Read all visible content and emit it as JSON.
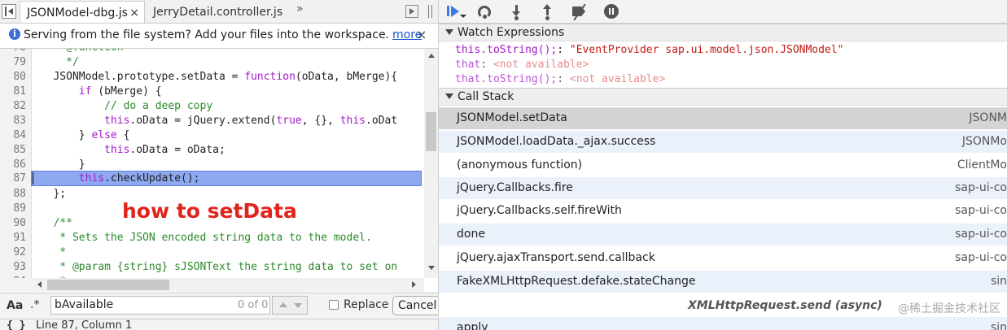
{
  "tabs": [
    {
      "label": "JSONModel-dbg.js",
      "close": "×"
    },
    {
      "label": "JerryDetail.controller.js"
    }
  ],
  "tabs_more": "»",
  "infobar": {
    "text": "Serving from the file system? Add your files into the workspace.",
    "link": "more",
    "close": "×"
  },
  "code_lines": [
    {
      "num": "78",
      "text": "     @function"
    },
    {
      "num": "79",
      "text": "     */"
    },
    {
      "num": "80",
      "text": "   JSONModel.prototype.setData = function(oData, bMerge){"
    },
    {
      "num": "81",
      "text": "       if (bMerge) {"
    },
    {
      "num": "82",
      "text": "           // do a deep copy"
    },
    {
      "num": "83",
      "text": "           this.oData = jQuery.extend(true, {}, this.oDat"
    },
    {
      "num": "84",
      "text": "       } else {"
    },
    {
      "num": "85",
      "text": "           this.oData = oData;"
    },
    {
      "num": "86",
      "text": "       }"
    },
    {
      "num": "87",
      "text": "       this.checkUpdate();"
    },
    {
      "num": "88",
      "text": "   };"
    },
    {
      "num": "89",
      "text": ""
    },
    {
      "num": "90",
      "text": "   /**"
    },
    {
      "num": "91",
      "text": "    * Sets the JSON encoded string data to the model."
    },
    {
      "num": "92",
      "text": "    *"
    },
    {
      "num": "93",
      "text": "    * @param {string} sJSONText the string data to set on"
    },
    {
      "num": "94",
      "text": "    *"
    }
  ],
  "annotation": "how to setData",
  "search": {
    "case_label": "Aa",
    "regex_label": ".*",
    "value": "bAvailable",
    "count": "0 of 0",
    "replace_label": "Replace",
    "cancel_label": "Cancel"
  },
  "status": {
    "braces": "{ }",
    "position": "Line 87, Column 1"
  },
  "watch": {
    "title": "Watch Expressions",
    "items": [
      {
        "name": "this.toString();",
        "sep": ": ",
        "value": "\"EventProvider sap.ui.model.json.JSONModel\""
      },
      {
        "name": "that",
        "sep": ": ",
        "value": "<not available>"
      },
      {
        "name": "that.toString();",
        "sep": ": ",
        "value": "<not available>"
      }
    ]
  },
  "call_stack": {
    "title": "Call Stack",
    "frames": [
      {
        "fn": "JSONModel.setData",
        "file": "JSONM"
      },
      {
        "fn": "JSONModel.loadData._ajax.success",
        "file": "JSONMo"
      },
      {
        "fn": "(anonymous function)",
        "file": "ClientMo"
      },
      {
        "fn": "jQuery.Callbacks.fire",
        "file": "sap-ui-co"
      },
      {
        "fn": "jQuery.Callbacks.self.fireWith",
        "file": "sap-ui-co"
      },
      {
        "fn": "done",
        "file": "sap-ui-co"
      },
      {
        "fn": "jQuery.ajaxTransport.send.callback",
        "file": "sap-ui-co"
      },
      {
        "fn": "FakeXMLHttpRequest.defake.stateChange",
        "file": "sin"
      }
    ],
    "async_label": "XMLHttpRequest.send (async)",
    "after_async": {
      "fn": "apply",
      "file": "sin"
    }
  },
  "watermark": "@稀土掘金技术社区"
}
